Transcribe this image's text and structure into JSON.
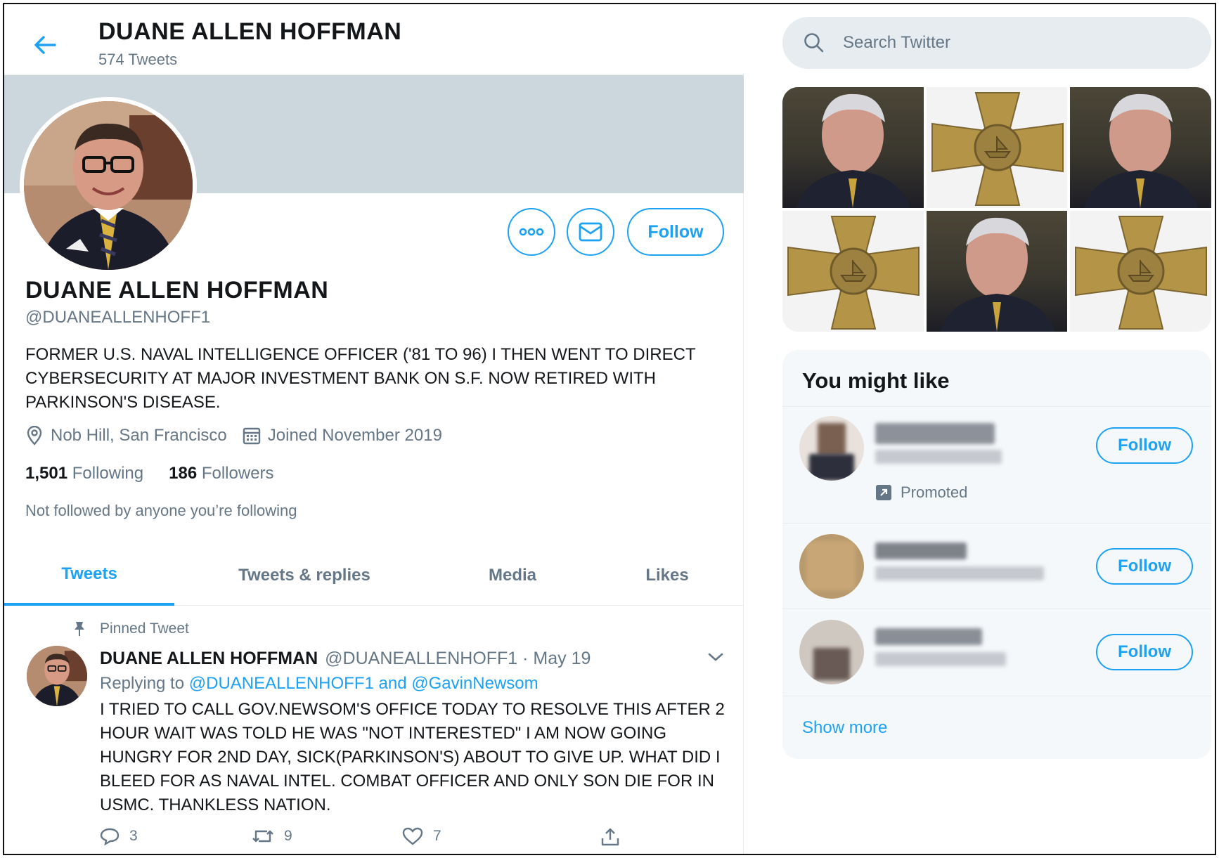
{
  "header": {
    "back_icon": "arrow-left-icon",
    "title": "DUANE ALLEN HOFFMAN",
    "tweet_count": "574 Tweets"
  },
  "profile": {
    "name": "DUANE ALLEN HOFFMAN",
    "handle": "@DUANEALLENHOFF1",
    "bio": "FORMER U.S. NAVAL INTELLIGENCE OFFICER ('81 TO 96) I THEN WENT TO DIRECT CYBERSECURITY AT MAJOR INVESTMENT BANK ON S.F. NOW RETIRED WITH PARKINSON'S DISEASE.",
    "location": "Nob Hill, San Francisco",
    "joined": "Joined November 2019",
    "following_count": "1,501",
    "following_label": "Following",
    "followers_count": "186",
    "followers_label": "Followers",
    "not_followed_note": "Not followed by anyone you’re following",
    "follow_label": "Follow",
    "more_icon": "more-options-icon",
    "message_icon": "envelope-icon"
  },
  "tabs": [
    {
      "label": "Tweets",
      "active": true
    },
    {
      "label": "Tweets & replies",
      "active": false
    },
    {
      "label": "Media",
      "active": false
    },
    {
      "label": "Likes",
      "active": false
    }
  ],
  "tweet": {
    "pinned_label": "Pinned Tweet",
    "author_name": "DUANE ALLEN HOFFMAN",
    "author_meta": "@DUANEALLENHOFF1 · May 19",
    "replying_prefix": "Replying to",
    "replying_to": "@DUANEALLENHOFF1 and @GavinNewsom",
    "text": "I TRIED TO CALL GOV.NEWSOM'S OFFICE TODAY TO RESOLVE THIS AFTER 2 HOUR WAIT WAS TOLD HE WAS \"NOT INTERESTED\" I AM NOW GOING HUNGRY FOR 2ND DAY, SICK(PARKINSON'S) ABOUT TO GIVE UP. WHAT DID I BLEED FOR AS NAVAL INTEL. COMBAT OFFICER AND ONLY SON DIE FOR IN USMC. THANKLESS NATION.",
    "replies": "3",
    "retweets": "9",
    "likes": "7"
  },
  "sidebar": {
    "search_placeholder": "Search Twitter",
    "media_grid": [
      "photo",
      "medal",
      "photo",
      "medal",
      "photo",
      "medal"
    ],
    "you_might_like": {
      "title": "You might like",
      "promoted_label": "Promoted",
      "follow_label": "Follow",
      "show_more": "Show more"
    }
  },
  "colors": {
    "accent": "#1da1f2",
    "secondary_text": "#657786",
    "banner": "#ccd6dd"
  }
}
